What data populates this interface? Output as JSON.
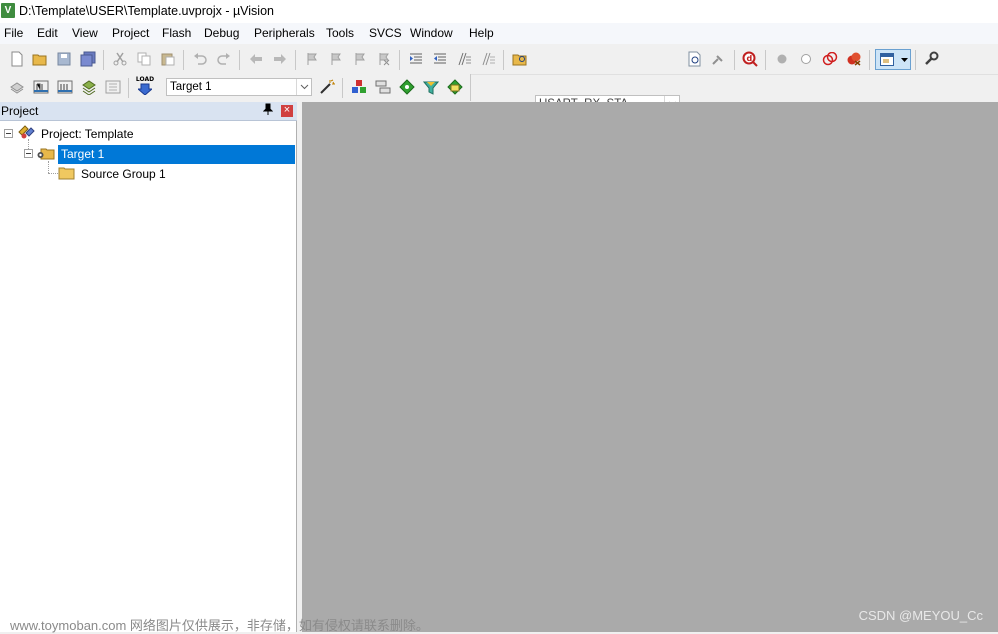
{
  "window": {
    "title": "D:\\Template\\USER\\Template.uvprojx - µVision",
    "app_icon": "uv-logo-icon"
  },
  "menu": [
    "File",
    "Edit",
    "View",
    "Project",
    "Flash",
    "Debug",
    "Peripherals",
    "Tools",
    "SVCS",
    "Window",
    "Help"
  ],
  "toolbar": {
    "find_combo": {
      "value": "USART_RX_STA"
    },
    "target_combo": {
      "value": "Target 1"
    },
    "load_label": "LOAD"
  },
  "project_panel": {
    "title": "Project",
    "pin_glyph": "ᵽ",
    "close_glyph": "×",
    "tree": {
      "root": "Project: Template",
      "target": "Target 1",
      "group": "Source Group 1"
    }
  },
  "watermarks": {
    "left": "www.toymoban.com 网络图片仅供展示，非存储，如有侵权请联系删除。",
    "right": "CSDN @MEYOU_Cc"
  },
  "colors": {
    "selection": "#0078d7",
    "editor_bg": "#aaaaaa",
    "panel_header": "#d9e3f1"
  }
}
